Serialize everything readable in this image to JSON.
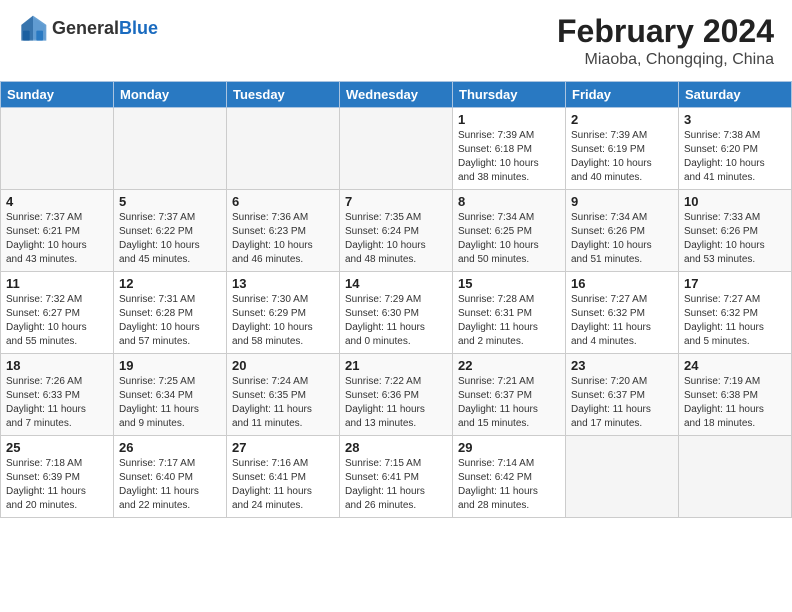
{
  "header": {
    "logo_general": "General",
    "logo_blue": "Blue",
    "month_year": "February 2024",
    "location": "Miaoba, Chongqing, China"
  },
  "weekdays": [
    "Sunday",
    "Monday",
    "Tuesday",
    "Wednesday",
    "Thursday",
    "Friday",
    "Saturday"
  ],
  "weeks": [
    [
      {
        "day": "",
        "info": ""
      },
      {
        "day": "",
        "info": ""
      },
      {
        "day": "",
        "info": ""
      },
      {
        "day": "",
        "info": ""
      },
      {
        "day": "1",
        "info": "Sunrise: 7:39 AM\nSunset: 6:18 PM\nDaylight: 10 hours\nand 38 minutes."
      },
      {
        "day": "2",
        "info": "Sunrise: 7:39 AM\nSunset: 6:19 PM\nDaylight: 10 hours\nand 40 minutes."
      },
      {
        "day": "3",
        "info": "Sunrise: 7:38 AM\nSunset: 6:20 PM\nDaylight: 10 hours\nand 41 minutes."
      }
    ],
    [
      {
        "day": "4",
        "info": "Sunrise: 7:37 AM\nSunset: 6:21 PM\nDaylight: 10 hours\nand 43 minutes."
      },
      {
        "day": "5",
        "info": "Sunrise: 7:37 AM\nSunset: 6:22 PM\nDaylight: 10 hours\nand 45 minutes."
      },
      {
        "day": "6",
        "info": "Sunrise: 7:36 AM\nSunset: 6:23 PM\nDaylight: 10 hours\nand 46 minutes."
      },
      {
        "day": "7",
        "info": "Sunrise: 7:35 AM\nSunset: 6:24 PM\nDaylight: 10 hours\nand 48 minutes."
      },
      {
        "day": "8",
        "info": "Sunrise: 7:34 AM\nSunset: 6:25 PM\nDaylight: 10 hours\nand 50 minutes."
      },
      {
        "day": "9",
        "info": "Sunrise: 7:34 AM\nSunset: 6:26 PM\nDaylight: 10 hours\nand 51 minutes."
      },
      {
        "day": "10",
        "info": "Sunrise: 7:33 AM\nSunset: 6:26 PM\nDaylight: 10 hours\nand 53 minutes."
      }
    ],
    [
      {
        "day": "11",
        "info": "Sunrise: 7:32 AM\nSunset: 6:27 PM\nDaylight: 10 hours\nand 55 minutes."
      },
      {
        "day": "12",
        "info": "Sunrise: 7:31 AM\nSunset: 6:28 PM\nDaylight: 10 hours\nand 57 minutes."
      },
      {
        "day": "13",
        "info": "Sunrise: 7:30 AM\nSunset: 6:29 PM\nDaylight: 10 hours\nand 58 minutes."
      },
      {
        "day": "14",
        "info": "Sunrise: 7:29 AM\nSunset: 6:30 PM\nDaylight: 11 hours\nand 0 minutes."
      },
      {
        "day": "15",
        "info": "Sunrise: 7:28 AM\nSunset: 6:31 PM\nDaylight: 11 hours\nand 2 minutes."
      },
      {
        "day": "16",
        "info": "Sunrise: 7:27 AM\nSunset: 6:32 PM\nDaylight: 11 hours\nand 4 minutes."
      },
      {
        "day": "17",
        "info": "Sunrise: 7:27 AM\nSunset: 6:32 PM\nDaylight: 11 hours\nand 5 minutes."
      }
    ],
    [
      {
        "day": "18",
        "info": "Sunrise: 7:26 AM\nSunset: 6:33 PM\nDaylight: 11 hours\nand 7 minutes."
      },
      {
        "day": "19",
        "info": "Sunrise: 7:25 AM\nSunset: 6:34 PM\nDaylight: 11 hours\nand 9 minutes."
      },
      {
        "day": "20",
        "info": "Sunrise: 7:24 AM\nSunset: 6:35 PM\nDaylight: 11 hours\nand 11 minutes."
      },
      {
        "day": "21",
        "info": "Sunrise: 7:22 AM\nSunset: 6:36 PM\nDaylight: 11 hours\nand 13 minutes."
      },
      {
        "day": "22",
        "info": "Sunrise: 7:21 AM\nSunset: 6:37 PM\nDaylight: 11 hours\nand 15 minutes."
      },
      {
        "day": "23",
        "info": "Sunrise: 7:20 AM\nSunset: 6:37 PM\nDaylight: 11 hours\nand 17 minutes."
      },
      {
        "day": "24",
        "info": "Sunrise: 7:19 AM\nSunset: 6:38 PM\nDaylight: 11 hours\nand 18 minutes."
      }
    ],
    [
      {
        "day": "25",
        "info": "Sunrise: 7:18 AM\nSunset: 6:39 PM\nDaylight: 11 hours\nand 20 minutes."
      },
      {
        "day": "26",
        "info": "Sunrise: 7:17 AM\nSunset: 6:40 PM\nDaylight: 11 hours\nand 22 minutes."
      },
      {
        "day": "27",
        "info": "Sunrise: 7:16 AM\nSunset: 6:41 PM\nDaylight: 11 hours\nand 24 minutes."
      },
      {
        "day": "28",
        "info": "Sunrise: 7:15 AM\nSunset: 6:41 PM\nDaylight: 11 hours\nand 26 minutes."
      },
      {
        "day": "29",
        "info": "Sunrise: 7:14 AM\nSunset: 6:42 PM\nDaylight: 11 hours\nand 28 minutes."
      },
      {
        "day": "",
        "info": ""
      },
      {
        "day": "",
        "info": ""
      }
    ]
  ]
}
